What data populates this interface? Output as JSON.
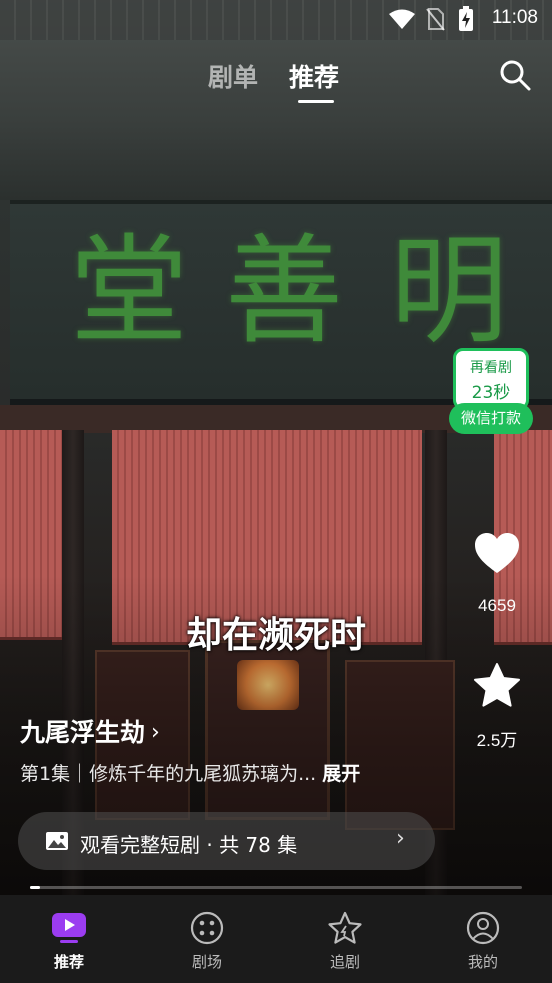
{
  "status_bar": {
    "time": "11:08"
  },
  "top_tabs": {
    "tab1": "剧单",
    "tab2": "推荐",
    "active": "推荐"
  },
  "plaque": {
    "chars": [
      "堂",
      "善",
      "明"
    ]
  },
  "reward": {
    "line1": "再看剧",
    "line2": "23秒",
    "button": "微信打款",
    "color": "#1fbf5b"
  },
  "actions": {
    "like_count": "4659",
    "favorite_count": "2.5万"
  },
  "subtitle": "却在濒死时",
  "drama": {
    "title": "九尾浮生劫",
    "episode_text": "第1集｜修炼千年的九尾狐苏璃为...",
    "expand_label": "展开"
  },
  "watch_full": {
    "label": "观看完整短剧 · 共 78 集"
  },
  "progress": {
    "fraction": 0.02
  },
  "bottom_nav": {
    "items": [
      {
        "label": "推荐",
        "icon": "play-tv-icon",
        "active": true
      },
      {
        "label": "剧场",
        "icon": "theater-dots-icon",
        "active": false
      },
      {
        "label": "追剧",
        "icon": "star-icon",
        "active": false
      },
      {
        "label": "我的",
        "icon": "profile-icon",
        "active": false
      }
    ],
    "accent_color": "#9b3cf0"
  }
}
